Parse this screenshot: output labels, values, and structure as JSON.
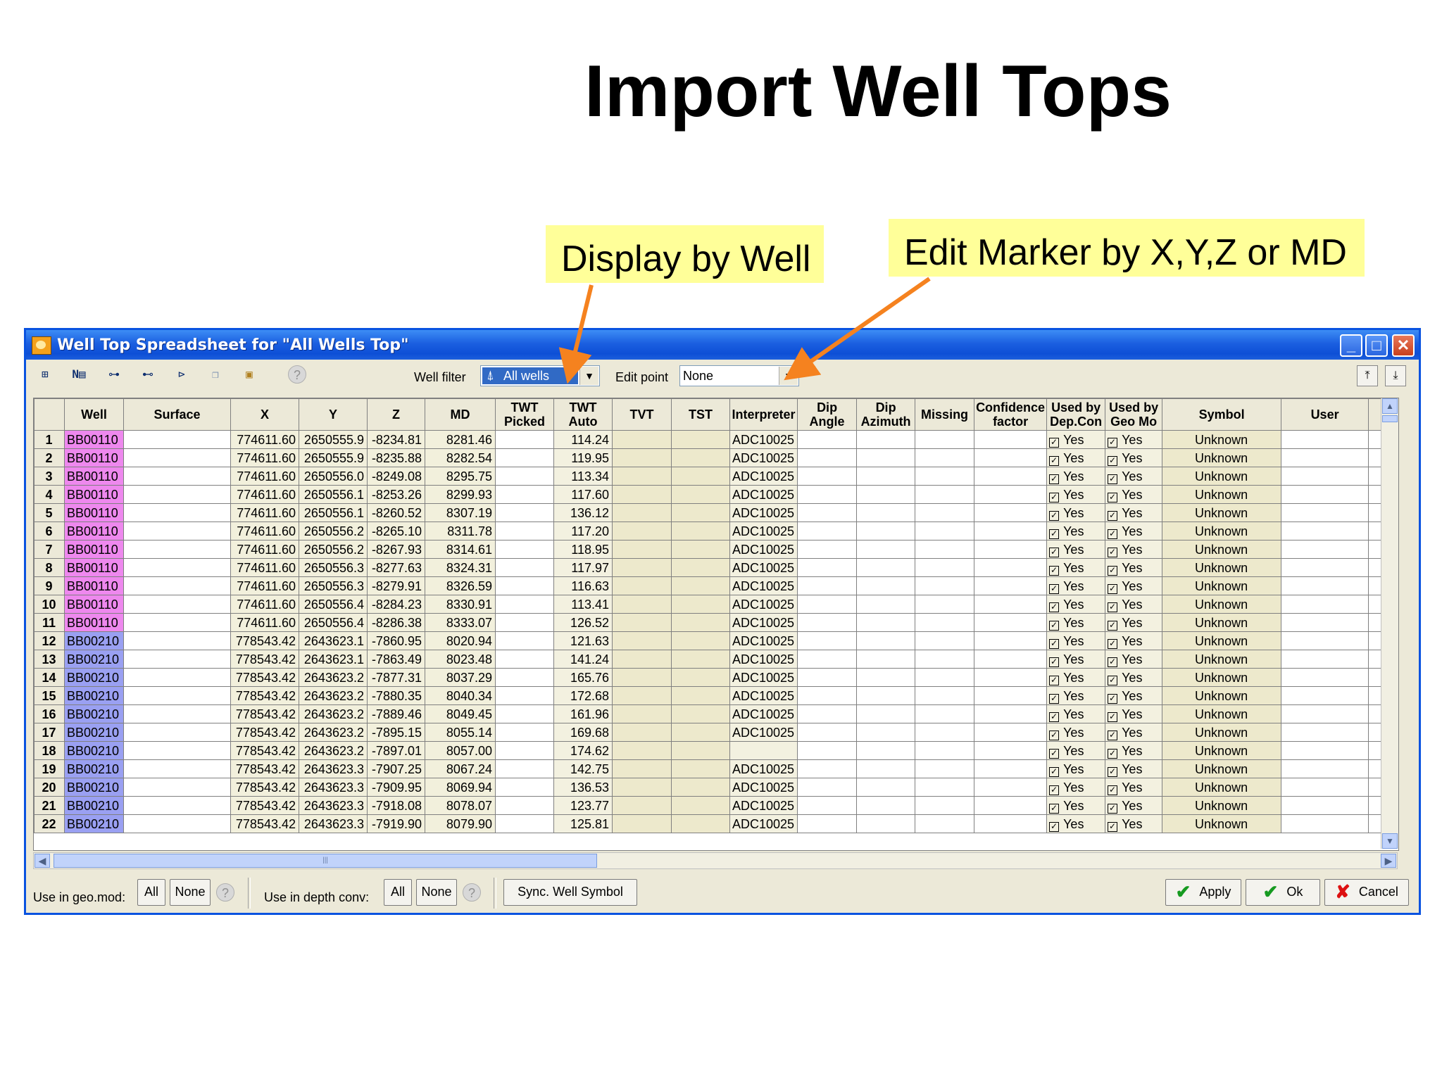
{
  "slide": {
    "title": "Import Well Tops",
    "callout_display": "Display by Well",
    "callout_edit": "Edit Marker by X,Y,Z or MD"
  },
  "window": {
    "title": "Well Top Spreadsheet for \"All Wells Top\"",
    "minimize_icon": "minimize-icon",
    "maximize_icon": "maximize-icon",
    "close_icon": "close-icon"
  },
  "toolbar": {
    "well_filter_label": "Well filter",
    "well_filter_value": "All wells",
    "edit_point_label": "Edit point",
    "edit_point_value": "None"
  },
  "columns": [
    "",
    "Well",
    "Surface",
    "X",
    "Y",
    "Z",
    "MD",
    "TWT Picked",
    "TWT Auto",
    "TVT",
    "TST",
    "Interpreter",
    "Dip Angle",
    "Dip Azimuth",
    "Missing",
    "Confidence factor",
    "Used by Dep.Con",
    "Used by Geo Mo",
    "Symbol",
    "User"
  ],
  "rows": [
    {
      "n": "1",
      "well": "BB00110",
      "x": "774611.60",
      "y": "2650555.9",
      "z": "-8234.81",
      "md": "8281.46",
      "twt": "114.24",
      "interp": "ADC10025",
      "dep": "Yes",
      "geo": "Yes",
      "symbol": "Unknown"
    },
    {
      "n": "2",
      "well": "BB00110",
      "x": "774611.60",
      "y": "2650555.9",
      "z": "-8235.88",
      "md": "8282.54",
      "twt": "119.95",
      "interp": "ADC10025",
      "dep": "Yes",
      "geo": "Yes",
      "symbol": "Unknown"
    },
    {
      "n": "3",
      "well": "BB00110",
      "x": "774611.60",
      "y": "2650556.0",
      "z": "-8249.08",
      "md": "8295.75",
      "twt": "113.34",
      "interp": "ADC10025",
      "dep": "Yes",
      "geo": "Yes",
      "symbol": "Unknown"
    },
    {
      "n": "4",
      "well": "BB00110",
      "x": "774611.60",
      "y": "2650556.1",
      "z": "-8253.26",
      "md": "8299.93",
      "twt": "117.60",
      "interp": "ADC10025",
      "dep": "Yes",
      "geo": "Yes",
      "symbol": "Unknown"
    },
    {
      "n": "5",
      "well": "BB00110",
      "x": "774611.60",
      "y": "2650556.1",
      "z": "-8260.52",
      "md": "8307.19",
      "twt": "136.12",
      "interp": "ADC10025",
      "dep": "Yes",
      "geo": "Yes",
      "symbol": "Unknown"
    },
    {
      "n": "6",
      "well": "BB00110",
      "x": "774611.60",
      "y": "2650556.2",
      "z": "-8265.10",
      "md": "8311.78",
      "twt": "117.20",
      "interp": "ADC10025",
      "dep": "Yes",
      "geo": "Yes",
      "symbol": "Unknown"
    },
    {
      "n": "7",
      "well": "BB00110",
      "x": "774611.60",
      "y": "2650556.2",
      "z": "-8267.93",
      "md": "8314.61",
      "twt": "118.95",
      "interp": "ADC10025",
      "dep": "Yes",
      "geo": "Yes",
      "symbol": "Unknown"
    },
    {
      "n": "8",
      "well": "BB00110",
      "x": "774611.60",
      "y": "2650556.3",
      "z": "-8277.63",
      "md": "8324.31",
      "twt": "117.97",
      "interp": "ADC10025",
      "dep": "Yes",
      "geo": "Yes",
      "symbol": "Unknown"
    },
    {
      "n": "9",
      "well": "BB00110",
      "x": "774611.60",
      "y": "2650556.3",
      "z": "-8279.91",
      "md": "8326.59",
      "twt": "116.63",
      "interp": "ADC10025",
      "dep": "Yes",
      "geo": "Yes",
      "symbol": "Unknown"
    },
    {
      "n": "10",
      "well": "BB00110",
      "x": "774611.60",
      "y": "2650556.4",
      "z": "-8284.23",
      "md": "8330.91",
      "twt": "113.41",
      "interp": "ADC10025",
      "dep": "Yes",
      "geo": "Yes",
      "symbol": "Unknown"
    },
    {
      "n": "11",
      "well": "BB00110",
      "x": "774611.60",
      "y": "2650556.4",
      "z": "-8286.38",
      "md": "8333.07",
      "twt": "126.52",
      "interp": "ADC10025",
      "dep": "Yes",
      "geo": "Yes",
      "symbol": "Unknown"
    },
    {
      "n": "12",
      "well": "BB00210",
      "x": "778543.42",
      "y": "2643623.1",
      "z": "-7860.95",
      "md": "8020.94",
      "twt": "121.63",
      "interp": "ADC10025",
      "dep": "Yes",
      "geo": "Yes",
      "symbol": "Unknown"
    },
    {
      "n": "13",
      "well": "BB00210",
      "x": "778543.42",
      "y": "2643623.1",
      "z": "-7863.49",
      "md": "8023.48",
      "twt": "141.24",
      "interp": "ADC10025",
      "dep": "Yes",
      "geo": "Yes",
      "symbol": "Unknown"
    },
    {
      "n": "14",
      "well": "BB00210",
      "x": "778543.42",
      "y": "2643623.2",
      "z": "-7877.31",
      "md": "8037.29",
      "twt": "165.76",
      "interp": "ADC10025",
      "dep": "Yes",
      "geo": "Yes",
      "symbol": "Unknown"
    },
    {
      "n": "15",
      "well": "BB00210",
      "x": "778543.42",
      "y": "2643623.2",
      "z": "-7880.35",
      "md": "8040.34",
      "twt": "172.68",
      "interp": "ADC10025",
      "dep": "Yes",
      "geo": "Yes",
      "symbol": "Unknown"
    },
    {
      "n": "16",
      "well": "BB00210",
      "x": "778543.42",
      "y": "2643623.2",
      "z": "-7889.46",
      "md": "8049.45",
      "twt": "161.96",
      "interp": "ADC10025",
      "dep": "Yes",
      "geo": "Yes",
      "symbol": "Unknown"
    },
    {
      "n": "17",
      "well": "BB00210",
      "x": "778543.42",
      "y": "2643623.2",
      "z": "-7895.15",
      "md": "8055.14",
      "twt": "169.68",
      "interp": "ADC10025",
      "dep": "Yes",
      "geo": "Yes",
      "symbol": "Unknown"
    },
    {
      "n": "18",
      "well": "BB00210",
      "x": "778543.42",
      "y": "2643623.2",
      "z": "-7897.01",
      "md": "8057.00",
      "twt": "174.62",
      "interp": "",
      "dep": "Yes",
      "geo": "Yes",
      "symbol": "Unknown"
    },
    {
      "n": "19",
      "well": "BB00210",
      "x": "778543.42",
      "y": "2643623.3",
      "z": "-7907.25",
      "md": "8067.24",
      "twt": "142.75",
      "interp": "ADC10025",
      "dep": "Yes",
      "geo": "Yes",
      "symbol": "Unknown"
    },
    {
      "n": "20",
      "well": "BB00210",
      "x": "778543.42",
      "y": "2643623.3",
      "z": "-7909.95",
      "md": "8069.94",
      "twt": "136.53",
      "interp": "ADC10025",
      "dep": "Yes",
      "geo": "Yes",
      "symbol": "Unknown"
    },
    {
      "n": "21",
      "well": "BB00210",
      "x": "778543.42",
      "y": "2643623.3",
      "z": "-7918.08",
      "md": "8078.07",
      "twt": "123.77",
      "interp": "ADC10025",
      "dep": "Yes",
      "geo": "Yes",
      "symbol": "Unknown"
    },
    {
      "n": "22",
      "well": "BB00210",
      "x": "778543.42",
      "y": "2643623.3",
      "z": "-7919.90",
      "md": "8079.90",
      "twt": "125.81",
      "interp": "ADC10025",
      "dep": "Yes",
      "geo": "Yes",
      "symbol": "Unknown"
    }
  ],
  "bottom": {
    "geo_label": "Use in geo.mod:",
    "depth_label": "Use in depth conv:",
    "all": "All",
    "none": "None",
    "sync": "Sync. Well Symbol",
    "apply": "Apply",
    "ok": "Ok",
    "cancel": "Cancel"
  },
  "colors": {
    "arrow": "#f5821f",
    "callout_bg": "#ffff99",
    "well_110": "#ee88ee",
    "well_210": "#9aa0f2",
    "titlebar": "#1b5fe0"
  }
}
